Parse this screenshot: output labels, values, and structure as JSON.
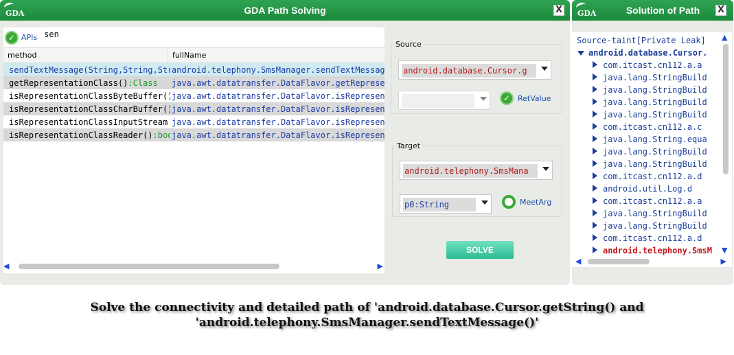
{
  "main_window": {
    "title": "GDA Path Solving",
    "logo_text": "GDA",
    "close_label": "X"
  },
  "apis": {
    "label": "APIs",
    "query": "sen"
  },
  "table": {
    "headers": [
      "method",
      "fullName"
    ],
    "rows": [
      {
        "method": "sendTextMessage(String,String,Str",
        "method_ret": "",
        "fullName": "android.telephony.SmsManager.sendTextMessage",
        "style": "sel"
      },
      {
        "method": "getRepresentationClass()",
        "method_ret": ":Class",
        "fullName": "java.awt.datatransfer.DataFlavor.getRepresent",
        "style": "alt"
      },
      {
        "method": "isRepresentationClassByteBuffer()",
        "method_ret": "",
        "fullName": "java.awt.datatransfer.DataFlavor.isRepresenta",
        "style": ""
      },
      {
        "method": "isRepresentationClassCharBuffer()",
        "method_ret": "",
        "fullName": "java.awt.datatransfer.DataFlavor.isRepresenta",
        "style": "alt"
      },
      {
        "method": "isRepresentationClassInputStream",
        "method_ret": "",
        "fullName": "java.awt.datatransfer.DataFlavor.isRepresenta",
        "style": ""
      },
      {
        "method": "isRepresentationClassReader()",
        "method_ret": ":boo",
        "fullName": "java.awt.datatransfer.DataFlavor.isRepresenta",
        "style": "alt"
      }
    ]
  },
  "source": {
    "legend": "Source",
    "method_value": "android.database.Cursor.g",
    "param_value": "",
    "option_label": "RetValue"
  },
  "target": {
    "legend": "Target",
    "method_value": "android.telephony.SmsMana",
    "param_value": "p0:String",
    "option_label": "MeetArg"
  },
  "solve_label": "SOLVE",
  "solution_window": {
    "title": "Solution of Path",
    "close_label": "X",
    "header": "Source-taint[Private Leak]",
    "root": "android.database.Cursor.",
    "nodes": [
      "com.itcast.cn112.a.a",
      "java.lang.StringBuild",
      "java.lang.StringBuild",
      "java.lang.StringBuild",
      "java.lang.StringBuild",
      "com.itcast.cn112.a.c",
      "java.lang.String.equa",
      "java.lang.StringBuild",
      "java.lang.StringBuild",
      "com.itcast.cn112.a.d",
      "android.util.Log.d",
      "com.itcast.cn112.a.a",
      "java.lang.StringBuild",
      "java.lang.StringBuild",
      "com.itcast.cn112.a.d"
    ],
    "last_node": "android.telephony.SmsM"
  },
  "caption": {
    "line1": "Solve the connectivity and detailed path of 'android.database.Cursor.getString() and",
    "line2": "'android.telephony.SmsManager.sendTextMessage()'"
  },
  "colors": {
    "title_green": "#1c8a3c",
    "selected_row": "#cfeaf1",
    "alt_row": "#d8d8d8",
    "combo_text": "#b21818",
    "solve_button": "#2dbb93"
  }
}
